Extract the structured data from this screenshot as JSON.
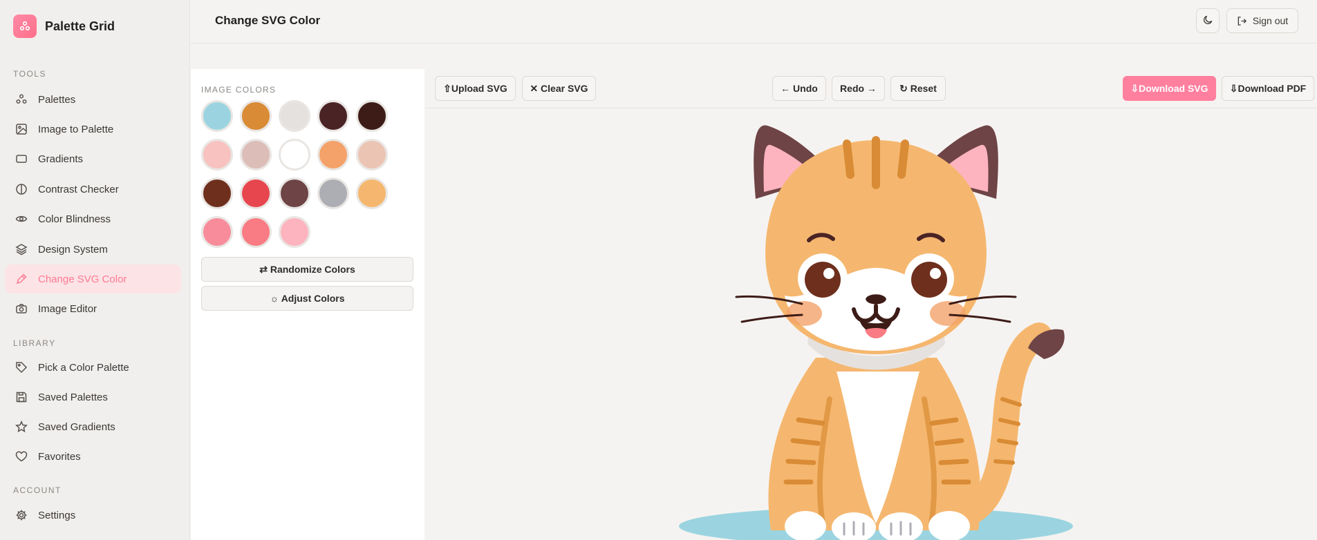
{
  "app": {
    "name": "Palette Grid",
    "brand_color": "#ff7a93"
  },
  "sidebar": {
    "sections": [
      {
        "label": "TOOLS"
      },
      {
        "label": "LIBRARY"
      },
      {
        "label": "ACCOUNT"
      }
    ],
    "items": [
      {
        "label": "Palettes",
        "icon": "palette-icon"
      },
      {
        "label": "Image to Palette",
        "icon": "image-icon"
      },
      {
        "label": "Gradients",
        "icon": "rectangle-icon"
      },
      {
        "label": "Contrast Checker",
        "icon": "contrast-icon"
      },
      {
        "label": "Color Blindness",
        "icon": "eye-icon"
      },
      {
        "label": "Design System",
        "icon": "layers-icon"
      },
      {
        "label": "Change SVG Color",
        "icon": "pen-icon",
        "active": true
      },
      {
        "label": "Image Editor",
        "icon": "camera-icon"
      },
      {
        "label": "Pick a Color Palette",
        "icon": "tag-icon"
      },
      {
        "label": "Saved Palettes",
        "icon": "save-icon"
      },
      {
        "label": "Saved Gradients",
        "icon": "star-icon"
      },
      {
        "label": "Favorites",
        "icon": "heart-icon"
      },
      {
        "label": "Settings",
        "icon": "gear-icon"
      }
    ]
  },
  "header": {
    "title": "Change SVG Color",
    "theme_toggle_icon": "moon-icon",
    "sign_out_label": "Sign out"
  },
  "panel": {
    "label": "IMAGE COLORS",
    "colors": [
      "#9bd4e0",
      "#d98b35",
      "#e5e1df",
      "#4a2325",
      "#3d1c17",
      "#f8c2c0",
      "#dcbdb7",
      "#ffffff",
      "#f4a26a",
      "#ebc4b3",
      "#6e2f1d",
      "#e8464f",
      "#6e4446",
      "#adadb4",
      "#f5b76f",
      "#f98c9b",
      "#f97b83",
      "#fdb4bf"
    ],
    "randomize_label": "⇄ Randomize Colors",
    "adjust_label": "☼ Adjust Colors"
  },
  "toolbar": {
    "upload_label": "⇧Upload SVG",
    "clear_label": "✕ Clear SVG",
    "undo_label": "← Undo",
    "redo_label": "Redo →",
    "reset_label": "↻ Reset",
    "download_svg_label": "⇩Download SVG",
    "download_pdf_label": "⇩Download PDF"
  }
}
